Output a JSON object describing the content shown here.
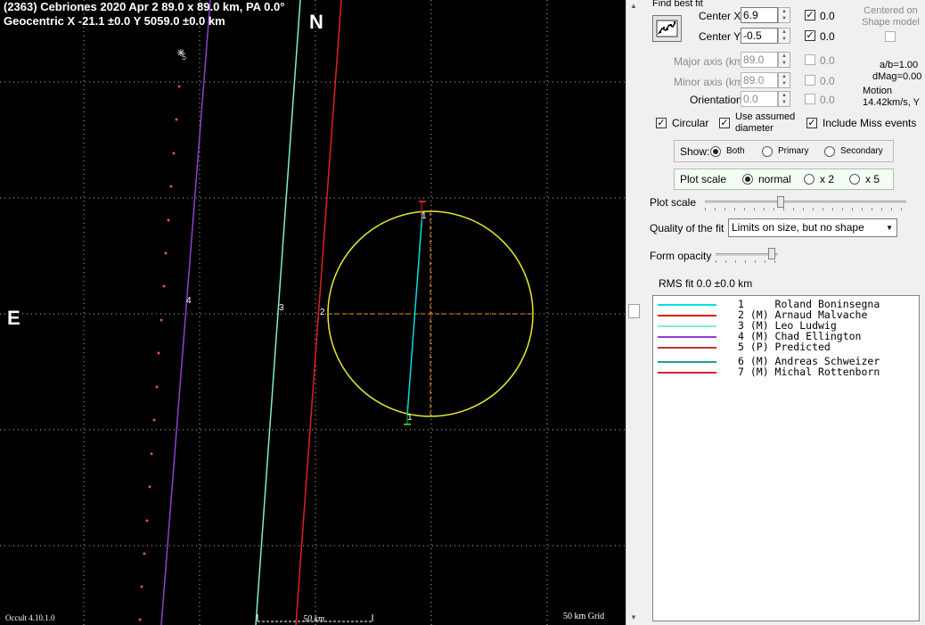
{
  "plot": {
    "title_line1": "(2363) Cebriones  2020 Apr 2   89.0 x 89.0 km, PA 0.0°",
    "title_line2": "Geocentric  X  -21.1 ±0.0  Y 5059.0 ±0.0 km",
    "north_label": "N",
    "east_label": "E",
    "version": "Occult 4.10.1.0",
    "grid_label": "50 km Grid",
    "scale_label": "50 km",
    "chord_labels": [
      "1",
      "2",
      "3",
      "4",
      "5",
      "1"
    ],
    "colors": {
      "ellipse": "#e8e830",
      "grid": "#c8c8c8",
      "axis": "#ff8c00"
    }
  },
  "panel": {
    "find_best_fit": "Find best fit",
    "fit_button_icon": "chart-fit-icon",
    "center_x_label": "Center X",
    "center_x_value": "6.9",
    "center_x_uncert": "0.0",
    "center_y_label": "Center Y",
    "center_y_value": "-0.5",
    "center_y_uncert": "0.0",
    "centered_on_shape": "Centered on\nShape model",
    "major_axis_label": "Major axis (km)",
    "major_axis_value": "89.0",
    "major_axis_uncert": "0.0",
    "minor_axis_label": "Minor axis (km)",
    "minor_axis_value": "89.0",
    "minor_axis_uncert": "0.0",
    "orientation_label": "Orientation",
    "orientation_value": "0.0",
    "orientation_uncert": "0.0",
    "ab_ratio": "a/b=1.00",
    "dmag": "dMag=0.00",
    "motion_label": "Motion",
    "motion_value": "14.42km/s, Y",
    "circular": "Circular",
    "use_assumed": "Use assumed\ndiameter",
    "include_miss": "Include Miss events",
    "show_label": "Show:",
    "show_both": "Both",
    "show_primary": "Primary",
    "show_secondary": "Secondary",
    "plot_scale_group": "Plot scale",
    "scale_normal": "normal",
    "scale_x2": "x 2",
    "scale_x5": "x 5",
    "plot_scale_slider": "Plot scale",
    "quality_label": "Quality of the fit",
    "quality_value": "Limits on size, but no shape",
    "form_opacity": "Form opacity",
    "rms_fit": "RMS fit 0.0 ±0.0 km"
  },
  "observers": [
    {
      "text": "1     Roland Boninsegna",
      "color": "#00e0e0"
    },
    {
      "text": "2 (M) Arnaud Malvache",
      "color": "#e02020"
    },
    {
      "text": "3 (M) Leo Ludwig",
      "color": "#80f0c0"
    },
    {
      "text": "4 (M) Chad Ellington",
      "color": "#9040d0"
    },
    {
      "text": "5 (P) Predicted",
      "color": "#c03040"
    },
    {
      "text": "6 (M) Andreas Schweizer",
      "color": "#20a090"
    },
    {
      "text": "7 (M) Michal Rottenborn",
      "color": "#d02030"
    }
  ]
}
